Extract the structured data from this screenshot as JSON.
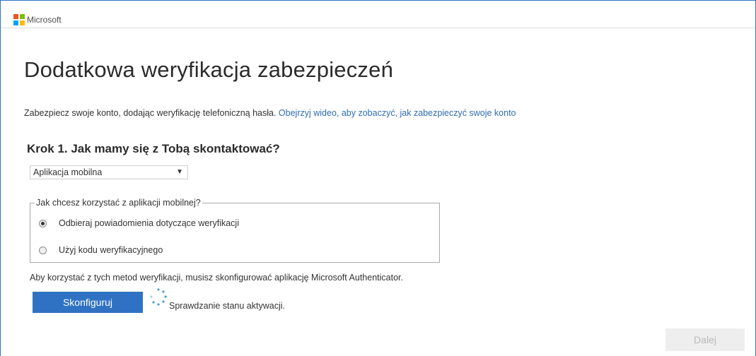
{
  "header": {
    "brand": "Microsoft",
    "logo_colors": [
      "#f25022",
      "#7fba00",
      "#00a4ef",
      "#ffb900"
    ]
  },
  "page": {
    "title": "Dodatkowa weryfikacja zabezpieczeń",
    "subtitle_text": "Zabezpiecz swoje konto, dodając weryfikację telefoniczną hasła. ",
    "subtitle_link": "Obejrzyj wideo, aby zobaczyć, jak zabezpieczyć swoje konto"
  },
  "step": {
    "heading": "Krok 1. Jak mamy się z Tobą skontaktować?",
    "contact_method": {
      "selected": "Aplikacja mobilna",
      "arrow": "▼"
    },
    "mobile_app_group": {
      "legend": "Jak chcesz korzystać z aplikacji mobilnej?",
      "options": [
        {
          "label": "Odbieraj powiadomienia dotyczące weryfikacji",
          "checked": true
        },
        {
          "label": "Użyj kodu weryfikacyjnego",
          "checked": false
        }
      ]
    },
    "info": "Aby korzystać z tych metod weryfikacji, musisz skonfigurować aplikację Microsoft Authenticator.",
    "configure_label": "Skonfiguruj",
    "status": "Sprawdzanie stanu aktywacji."
  },
  "footer": {
    "next_label": "Dalej"
  },
  "colors": {
    "accent": "#2f72c4",
    "link": "#2e6db3",
    "spinner": "#3ea3d8",
    "disabled_bg": "#eeeeee",
    "disabled_text": "#b8b8b8"
  },
  "icons": {
    "spinner": "loading-spinner-icon",
    "dropdown": "chevron-down-icon"
  }
}
